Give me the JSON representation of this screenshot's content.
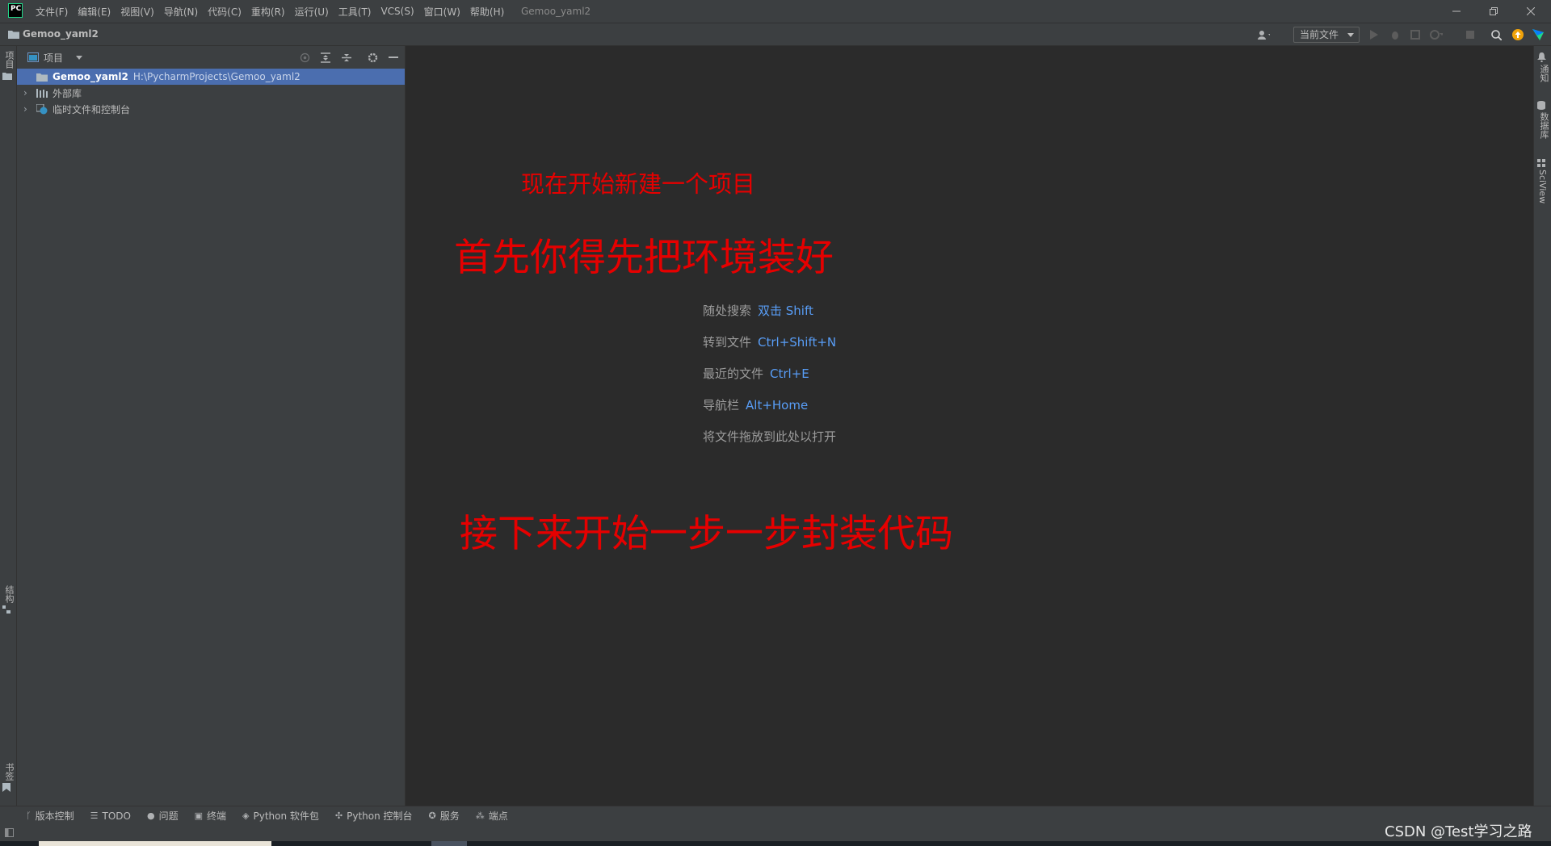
{
  "titlebar": {
    "logo_text": "PC",
    "menu": [
      "文件(F)",
      "编辑(E)",
      "视图(V)",
      "导航(N)",
      "代码(C)",
      "重构(R)",
      "运行(U)",
      "工具(T)",
      "VCS(S)",
      "窗口(W)",
      "帮助(H)"
    ],
    "title": "Gemoo_yaml2"
  },
  "navbar": {
    "project_name": "Gemoo_yaml2",
    "run_config": "当前文件"
  },
  "left_stripe": {
    "top_label": "项目",
    "structure_label": "结构",
    "bookmarks_label": "书签"
  },
  "right_stripe": {
    "notifications_label": "通知",
    "database_label": "数据库",
    "sciview_label": "SciView"
  },
  "project_panel": {
    "title": "项目",
    "tree": [
      {
        "name": "Gemoo_yaml2",
        "path": "H:\\PycharmProjects\\Gemoo_yaml2",
        "selected": true
      },
      {
        "name": "外部库"
      },
      {
        "name": "临时文件和控制台"
      }
    ]
  },
  "editor": {
    "overlay_1": "现在开始新建一个项目",
    "overlay_2": "首先你得先把环境装好",
    "overlay_3": "接下来开始一步一步封装代码",
    "hints": [
      {
        "label": "随处搜索",
        "key": "双击 Shift"
      },
      {
        "label": "转到文件",
        "key": "Ctrl+Shift+N"
      },
      {
        "label": "最近的文件",
        "key": "Ctrl+E"
      },
      {
        "label": "导航栏",
        "key": "Alt+Home"
      },
      {
        "label": "将文件拖放到此处以打开",
        "key": ""
      }
    ]
  },
  "tool_windows": [
    "版本控制",
    "TODO",
    "问题",
    "终端",
    "Python 软件包",
    "Python 控制台",
    "服务",
    "端点"
  ],
  "watermark": "CSDN @Test学习之路",
  "colors": {
    "accent_selection": "#4b6eaf",
    "shortcut_blue": "#589df6",
    "annotation_red": "#e60000",
    "panel_bg": "#3c3f41",
    "editor_bg": "#2b2b2b"
  }
}
